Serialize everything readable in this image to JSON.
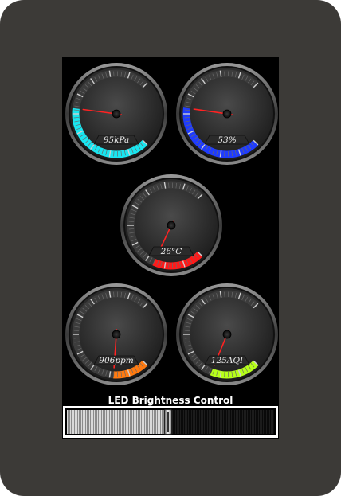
{
  "gauges": [
    {
      "id": "pressure",
      "label": "95kPa",
      "value": 95,
      "min": 0,
      "max": 180,
      "color": "#19e6f0"
    },
    {
      "id": "humidity",
      "label": "53%",
      "value": 53,
      "min": 0,
      "max": 100,
      "color": "#1f3cff"
    },
    {
      "id": "temperature",
      "label": "26°C",
      "value": 26,
      "min": 0,
      "max": 100,
      "color": "#ff1a1a"
    },
    {
      "id": "co2",
      "label": "906ppm",
      "value": 906,
      "min": 0,
      "max": 5000,
      "color": "#ff7a10"
    },
    {
      "id": "aqi",
      "label": "125AQI",
      "value": 125,
      "min": 0,
      "max": 500,
      "color": "#b6ff1a"
    }
  ],
  "slider": {
    "title": "LED Brightness Control",
    "value": 0.49
  }
}
